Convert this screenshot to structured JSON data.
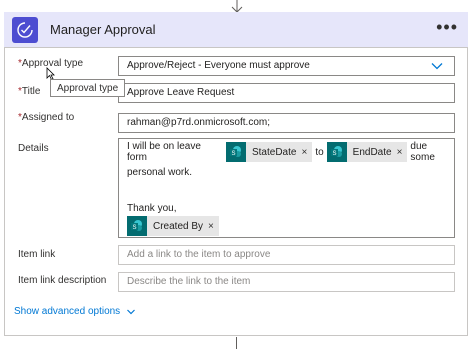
{
  "card": {
    "title": "Manager Approval",
    "more": "•••",
    "colors": {
      "header": "#e6e6fa",
      "logo": "#4d4dd1",
      "token_icon": "#036c70",
      "link": "#0078d4"
    }
  },
  "fields": {
    "approval_type": {
      "label": "Approval type",
      "required": "*",
      "value": "Approve/Reject - Everyone must approve"
    },
    "title": {
      "label": "Title",
      "required": "*",
      "value": "Approve Leave Request"
    },
    "assigned_to": {
      "label": "Assigned to",
      "required": "*",
      "value": "rahman@p7rd.onmicrosoft.com;"
    },
    "details": {
      "label": "Details",
      "text1": "I will be on leave form",
      "token1": "StateDate",
      "text2": "to",
      "token2": "EndDate",
      "text3": "due some",
      "text4": "personal work.",
      "text5": "Thank you,",
      "token3": "Created By",
      "token_close": "×"
    },
    "item_link": {
      "label": "Item link",
      "placeholder": "Add a link to the item to approve"
    },
    "item_link_description": {
      "label": "Item link description",
      "placeholder": "Describe the link to the item"
    }
  },
  "tooltip": "Approval type",
  "advanced": "Show advanced options",
  "icons": [
    "down-arrow-icon",
    "approval-check-icon",
    "more-options-icon",
    "chevron-down-icon",
    "sharepoint-icon",
    "close-icon",
    "mouse-cursor-icon"
  ]
}
